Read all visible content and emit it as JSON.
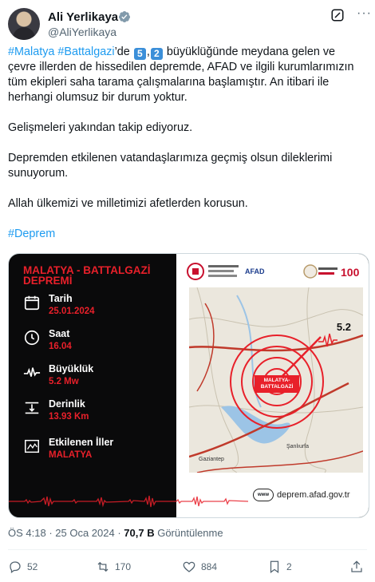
{
  "author": {
    "name": "Ali Yerlikaya",
    "handle": "@AliYerlikaya"
  },
  "tweet": {
    "hashtag1": "#Malatya",
    "hashtag2": "#Battalgazi",
    "p1_suffix": "’de",
    "mag_digit1": "5",
    "mag_sep": ",",
    "mag_digit2": "2",
    "p1_rest": " büyüklüğünde meydana gelen ve çevre illerden de hissedilen depremde, AFAD ve ilgili kurumlarımızın tüm ekipleri saha tarama çalışmalarına başlamıştır. An itibari ile herhangi olumsuz bir durum yoktur.",
    "p2": "Gelişmeleri yakından takip ediyoruz.",
    "p3": "Depremden etkilenen vatandaşlarımıza geçmiş olsun dileklerimi sunuyorum.",
    "p4": "Allah ülkemizi ve milletimizi afetlerden korusun.",
    "hashtag3": "#Deprem"
  },
  "card": {
    "title_line1": "MALATYA - BATTALGAZİ",
    "title_line2": "DEPREMİ",
    "items": [
      {
        "label": "Tarih",
        "value": "25.01.2024",
        "icon": "calendar-icon"
      },
      {
        "label": "Saat",
        "value": "16.04",
        "icon": "clock-icon"
      },
      {
        "label": "Büyüklük",
        "value": "5.2 Mw",
        "icon": "pulse-icon"
      },
      {
        "label": "Derinlik",
        "value": "13.93 Km",
        "icon": "depth-icon"
      },
      {
        "label": "Etkilenen İller",
        "value": "MALATYA",
        "icon": "map-icon"
      }
    ],
    "map_magnitude": "5.2",
    "map_label_line1": "MALATYA-",
    "map_label_line2": "BATTALGAZİ",
    "map_place1": "Gaziantep",
    "map_place2": "Şanlıurfa",
    "logo_afad": "AFAD",
    "logo_100": "100",
    "website": "deprem.afad.gov.tr",
    "www": "www"
  },
  "meta": {
    "time": "ÖS 4:18",
    "sep": " · ",
    "date": "25 Oca 2024",
    "views_count": "70,7 B",
    "views_label": "Görüntülenme"
  },
  "actions": {
    "replies": "52",
    "reposts": "170",
    "likes": "884",
    "bookmarks": "2"
  },
  "colors": {
    "link": "#1d9bf0",
    "red": "#e8202a",
    "card_bg": "#0a0a0b"
  }
}
